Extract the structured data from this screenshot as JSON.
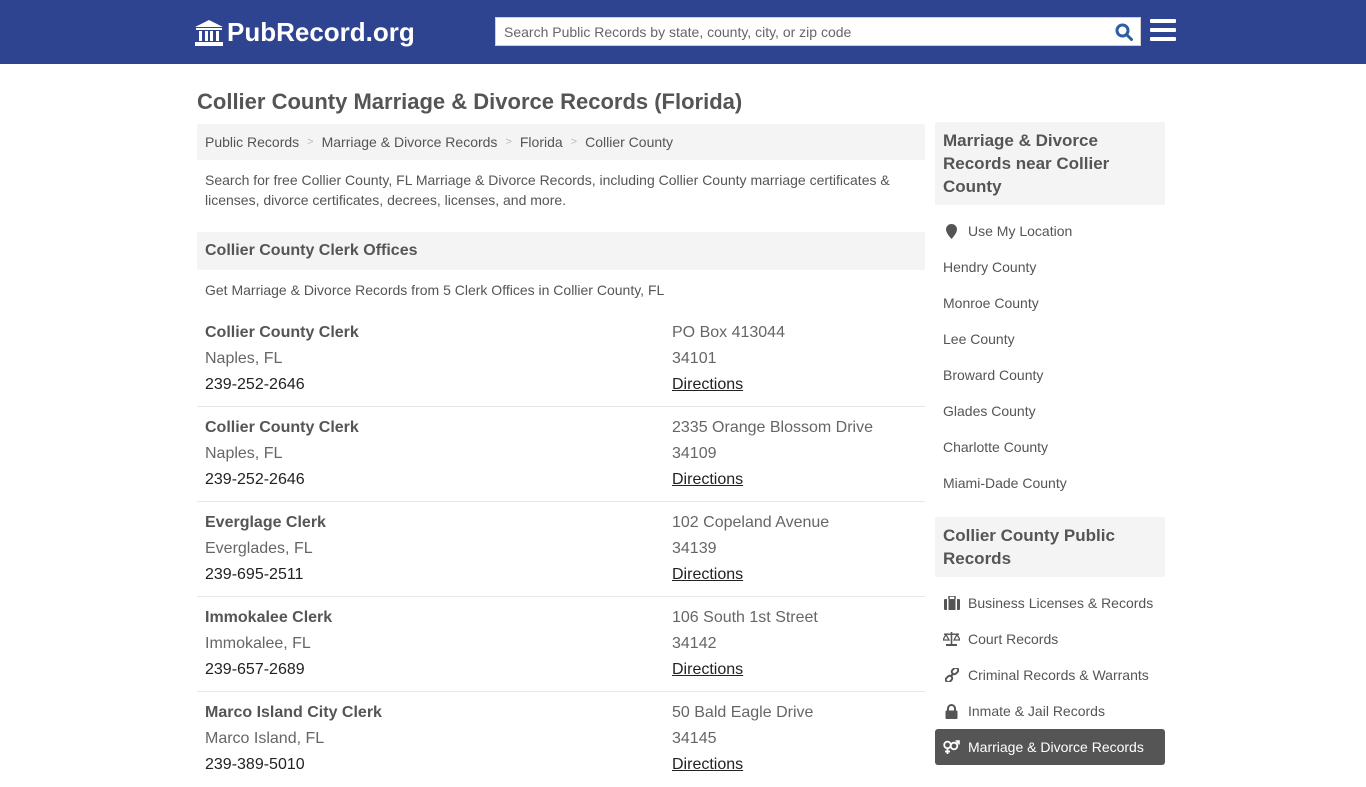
{
  "header": {
    "logo_text": "PubRecord.org",
    "search_placeholder": "Search Public Records by state, county, city, or zip code",
    "brand_color": "#2e4490"
  },
  "page_title": "Collier County Marriage & Divorce Records (Florida)",
  "breadcrumb": [
    "Public Records",
    "Marriage & Divorce Records",
    "Florida",
    "Collier County"
  ],
  "intro": "Search for free Collier County, FL Marriage & Divorce Records, including Collier County marriage certificates & licenses, divorce certificates, decrees, licenses, and more.",
  "clerk_section": {
    "title": "Collier County Clerk Offices",
    "subtitle": "Get Marriage & Divorce Records from 5 Clerk Offices in Collier County, FL",
    "offices": [
      {
        "name": "Collier County Clerk",
        "city": "Naples, FL",
        "phone": "239-252-2646",
        "address": "PO Box 413044",
        "zip": "34101",
        "directions": "Directions"
      },
      {
        "name": "Collier County Clerk",
        "city": "Naples, FL",
        "phone": "239-252-2646",
        "address": "2335 Orange Blossom Drive",
        "zip": "34109",
        "directions": "Directions"
      },
      {
        "name": "Everglage Clerk",
        "city": "Everglades, FL",
        "phone": "239-695-2511",
        "address": "102 Copeland Avenue",
        "zip": "34139",
        "directions": "Directions"
      },
      {
        "name": "Immokalee Clerk",
        "city": "Immokalee, FL",
        "phone": "239-657-2689",
        "address": "106 South 1st Street",
        "zip": "34142",
        "directions": "Directions"
      },
      {
        "name": "Marco Island City Clerk",
        "city": "Marco Island, FL",
        "phone": "239-389-5010",
        "address": "50 Bald Eagle Drive",
        "zip": "34145",
        "directions": "Directions"
      }
    ]
  },
  "sidebar": {
    "nearby_title": "Marriage & Divorce Records near Collier County",
    "use_location": "Use My Location",
    "nearby": [
      "Hendry County",
      "Monroe County",
      "Lee County",
      "Broward County",
      "Glades County",
      "Charlotte County",
      "Miami-Dade County"
    ],
    "public_title": "Collier County Public Records",
    "public_records": [
      {
        "label": "Business Licenses & Records",
        "icon": "briefcase-icon"
      },
      {
        "label": "Court Records",
        "icon": "scales-icon"
      },
      {
        "label": "Criminal Records & Warrants",
        "icon": "link-icon"
      },
      {
        "label": "Inmate & Jail Records",
        "icon": "lock-icon"
      },
      {
        "label": "Marriage & Divorce Records",
        "icon": "genders-icon",
        "active": true
      }
    ]
  }
}
